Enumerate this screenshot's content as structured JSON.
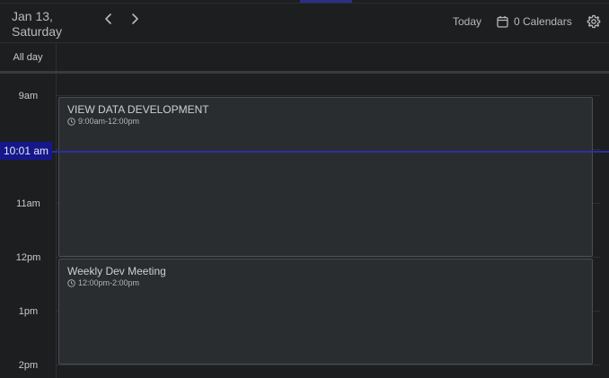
{
  "header": {
    "date_title": "Jan 13, Saturday",
    "prev_icon": "chevron-left-icon",
    "next_icon": "chevron-right-icon",
    "today_label": "Today",
    "calendars_icon": "calendar-icon",
    "calendars_label": "0 Calendars",
    "settings_icon": "gear-icon"
  },
  "allday": {
    "label": "All day"
  },
  "hours": [
    "9am",
    "11am",
    "12pm",
    "1pm",
    "2pm"
  ],
  "current_time": {
    "label": "10:01 am",
    "color": "#15178a"
  },
  "events": [
    {
      "title": "VIEW DATA DEVELOPMENT",
      "time": "9:00am-12:00pm"
    },
    {
      "title": "Weekly Dev Meeting",
      "time": "12:00pm-2:00pm"
    }
  ],
  "colors": {
    "background": "#1d1e20",
    "event_bg": "#2a2d30",
    "event_border": "#4a4d52",
    "now_accent": "#2b2ea4"
  }
}
